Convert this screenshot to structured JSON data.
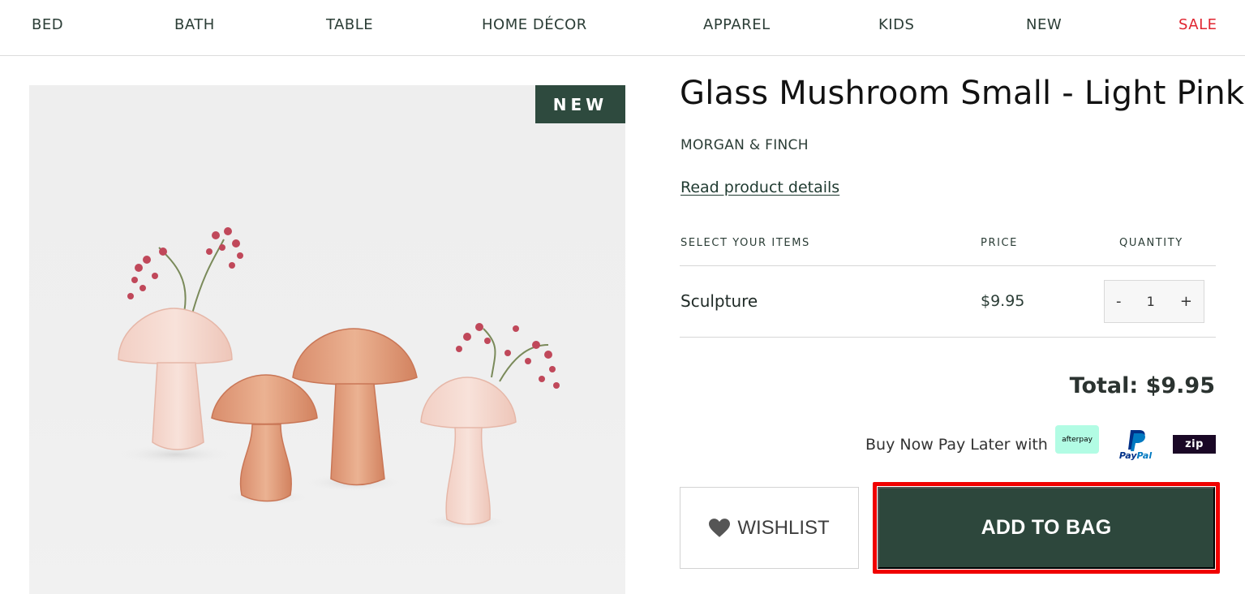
{
  "nav": {
    "items": [
      "BED",
      "BATH",
      "TABLE",
      "HOME DÉCOR",
      "APPAREL",
      "KIDS",
      "NEW",
      "SALE"
    ]
  },
  "product": {
    "badge": "NEW",
    "title": "Glass Mushroom Small - Light Pink",
    "brand": "MORGAN & FINCH",
    "details_link": "Read product details"
  },
  "items_table": {
    "headers": [
      "SELECT YOUR ITEMS",
      "PRICE",
      "QUANTITY"
    ],
    "rows": [
      {
        "name": "Sculpture",
        "price": "$9.95",
        "quantity": "1"
      }
    ],
    "minus": "-",
    "plus": "+"
  },
  "total": "Total: $9.95",
  "bnpl": {
    "label": "Buy Now Pay Later with",
    "afterpay": "afterpay",
    "paypal_pay": "Pay",
    "paypal_pal": "Pal",
    "zip": "zip"
  },
  "actions": {
    "wishlist": "WISHLIST",
    "add_to_bag": "ADD TO BAG"
  },
  "colors": {
    "brand_green": "#2d473c",
    "sale_red": "#e0242f",
    "highlight_red": "#f00000"
  }
}
